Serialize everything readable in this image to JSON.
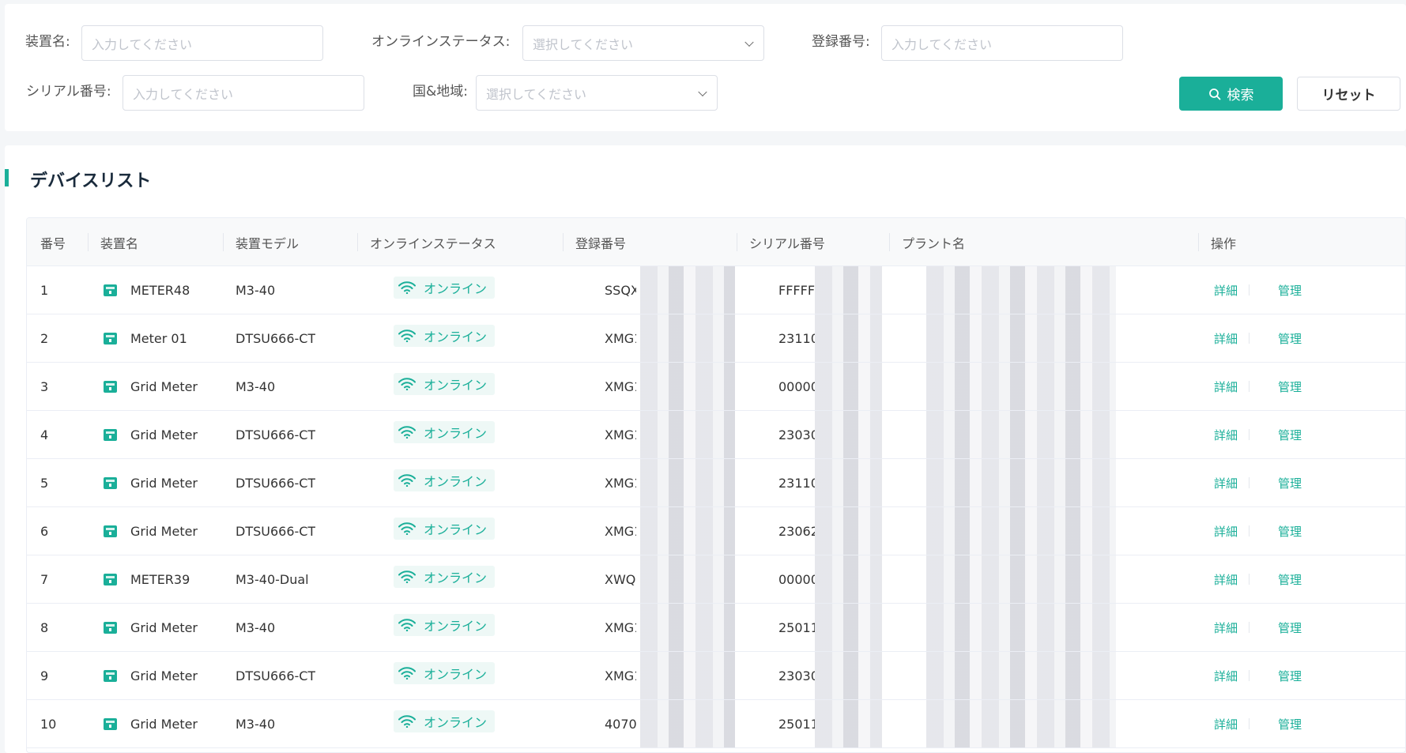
{
  "filters": {
    "device_name": {
      "label": "装置名:",
      "placeholder": "入力してください"
    },
    "online_status": {
      "label": "オンラインステータス:",
      "placeholder": "選択してください"
    },
    "registration_no": {
      "label": "登録番号:",
      "placeholder": "入力してください"
    },
    "serial_no": {
      "label": "シリアル番号:",
      "placeholder": "入力してください"
    },
    "country_region": {
      "label": "国&地域:",
      "placeholder": "選択してください"
    },
    "search_label": "検索",
    "reset_label": "リセット"
  },
  "list": {
    "title": "デバイスリスト",
    "columns": [
      "番号",
      "装置名",
      "装置モデル",
      "オンラインステータス",
      "登録番号",
      "シリアル番号",
      "プラント名",
      "操作"
    ],
    "detail_label": "詳細",
    "manage_label": "管理",
    "rows": [
      {
        "no": "1",
        "name": "METER48",
        "model": "M3-40",
        "status": "オンライン",
        "reg": "SSQXS",
        "serial": "FFFFF"
      },
      {
        "no": "2",
        "name": "Meter 01",
        "model": "DTSU666-CT",
        "status": "オンライン",
        "reg": "XMG1(",
        "serial": "23110"
      },
      {
        "no": "3",
        "name": "Grid Meter",
        "model": "M3-40",
        "status": "オンライン",
        "reg": "XMG1(",
        "serial": "00000"
      },
      {
        "no": "4",
        "name": "Grid Meter",
        "model": "DTSU666-CT",
        "status": "オンライン",
        "reg": "XMG1(",
        "serial": "23030"
      },
      {
        "no": "5",
        "name": "Grid Meter",
        "model": "DTSU666-CT",
        "status": "オンライン",
        "reg": "XMG1",
        "serial": "23110"
      },
      {
        "no": "6",
        "name": "Grid Meter",
        "model": "DTSU666-CT",
        "status": "オンライン",
        "reg": "XMG1(",
        "serial": "23062"
      },
      {
        "no": "7",
        "name": "METER39",
        "model": "M3-40-Dual",
        "status": "オンライン",
        "reg": "XWQM",
        "serial": "00000"
      },
      {
        "no": "8",
        "name": "Grid Meter",
        "model": "M3-40",
        "status": "オンライン",
        "reg": "XMG1(",
        "serial": "25011"
      },
      {
        "no": "9",
        "name": "Grid Meter",
        "model": "DTSU666-CT",
        "status": "オンライン",
        "reg": "XMG1",
        "serial": "23030"
      },
      {
        "no": "10",
        "name": "Grid Meter",
        "model": "M3-40",
        "status": "オンライン",
        "reg": "40702",
        "serial": "25011"
      }
    ]
  },
  "colors": {
    "accent": "#1aaf99",
    "status_bg": "#eef8f6"
  },
  "icons": {
    "search": "search-icon",
    "meter": "meter-icon",
    "wifi": "wifi-icon",
    "dropdown": "chevron-down-icon"
  }
}
